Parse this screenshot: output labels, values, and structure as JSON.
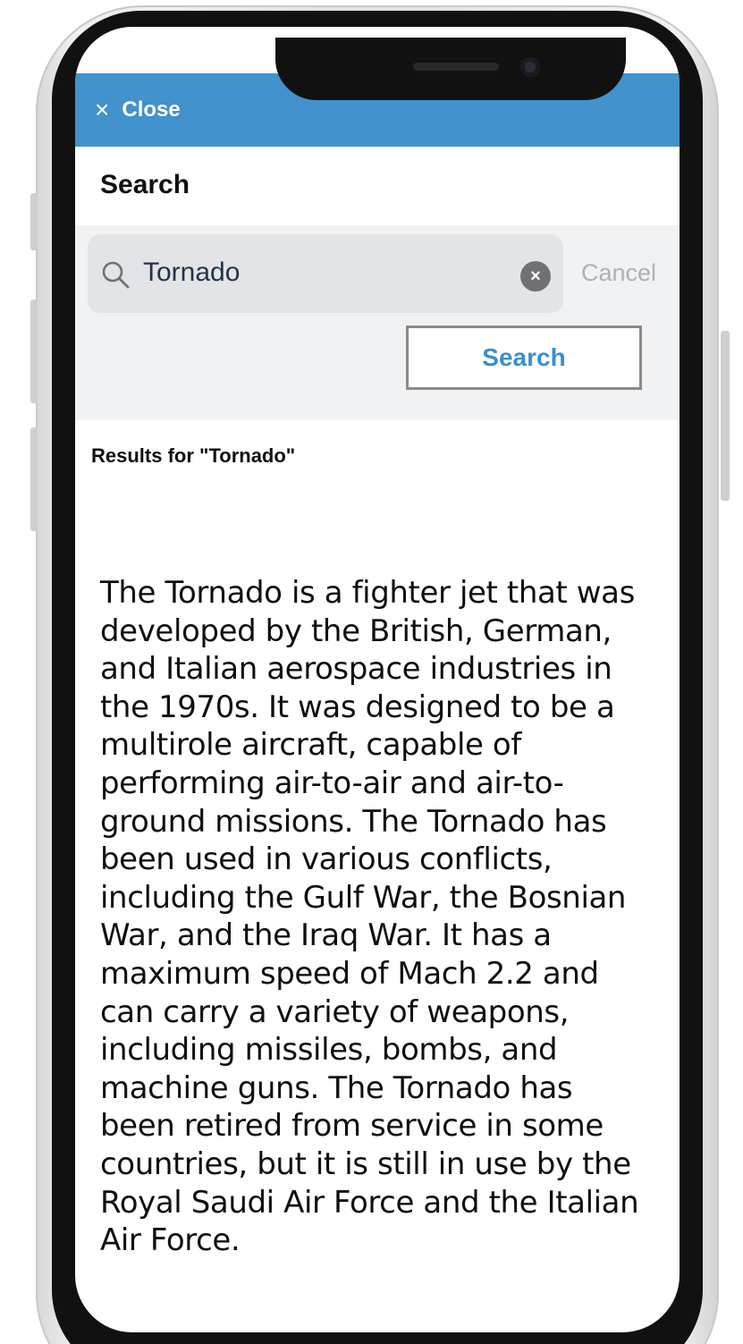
{
  "header": {
    "close_label": "Close",
    "close_icon": "×"
  },
  "search": {
    "title": "Search",
    "query": "Tornado",
    "clear_icon": "×",
    "cancel_label": "Cancel",
    "submit_label": "Search"
  },
  "results": {
    "heading": "Results for \"Tornado\"",
    "body": "The Tornado is a fighter jet that was developed by the British, German, and Italian aerospace industries in the 1970s. It was designed to be a multirole aircraft, capable of performing air-to-air and air-to-ground missions. The Tornado has been used in various conflicts, including the Gulf War, the Bosnian War, and the Iraq War. It has a maximum speed of Mach 2.2 and can carry a variety of weapons, including missiles, bombs, and machine guns. The Tornado has been retired from service in some countries, but it is still in use by the Royal Saudi Air Force and the Italian Air Force."
  },
  "colors": {
    "topbar": "#4192cd",
    "accent_text": "#3c8fcc",
    "panel_bg": "#f1f2f4",
    "search_box_bg": "#e3e4e6",
    "cancel_text": "#aeb1b5"
  },
  "icons": {
    "close": "close-icon",
    "search": "search-icon",
    "clear": "clear-search-icon"
  }
}
